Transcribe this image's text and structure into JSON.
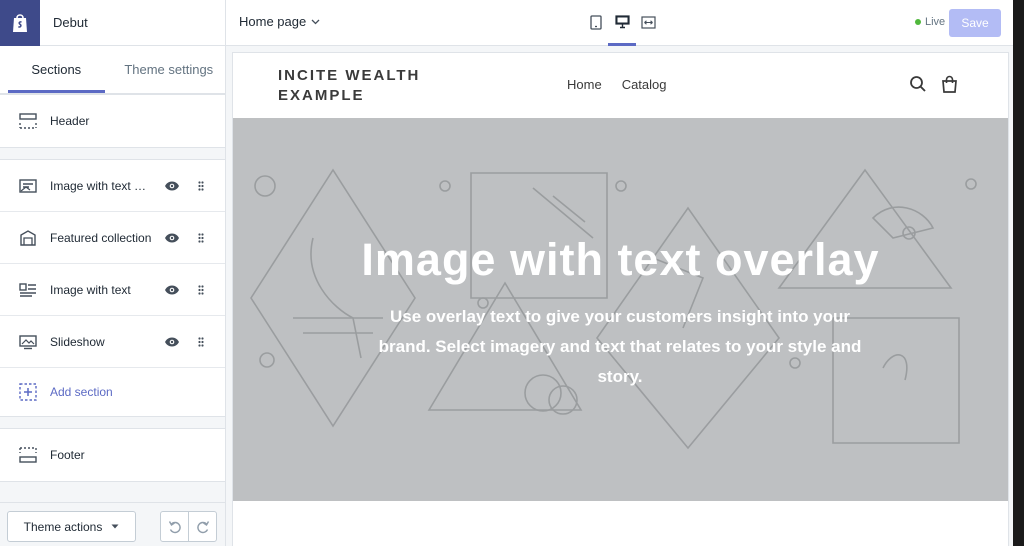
{
  "sidebar": {
    "theme_name": "Debut",
    "tabs": [
      {
        "label": "Sections",
        "active": true
      },
      {
        "label": "Theme settings",
        "active": false
      }
    ],
    "header_section": {
      "label": "Header",
      "icon": "header-layout-icon"
    },
    "sections": [
      {
        "label": "Image with text overlay",
        "icon": "image-text-overlay-icon"
      },
      {
        "label": "Featured collection",
        "icon": "collection-icon"
      },
      {
        "label": "Image with text",
        "icon": "image-with-text-icon"
      },
      {
        "label": "Slideshow",
        "icon": "slideshow-icon"
      }
    ],
    "add_section": {
      "label": "Add section",
      "icon": "add-section-icon"
    },
    "footer_section": {
      "label": "Footer",
      "icon": "footer-layout-icon"
    },
    "theme_actions_label": "Theme actions"
  },
  "topbar": {
    "page_select": "Home page",
    "live_label": "Live",
    "save_label": "Save"
  },
  "store": {
    "title": "INCITE WEALTH EXAMPLE",
    "nav": [
      "Home",
      "Catalog"
    ],
    "hero_title": "Image with text overlay",
    "hero_text": "Use overlay text to give your customers insight into your brand. Select imagery and text that relates to your style and story."
  },
  "colors": {
    "accent": "#5c6ac4",
    "logo_bg": "#3e4a8a",
    "save_disabled": "#b3bcf5",
    "live_dot": "#50b83c",
    "hero_bg": "#bec0c2"
  }
}
